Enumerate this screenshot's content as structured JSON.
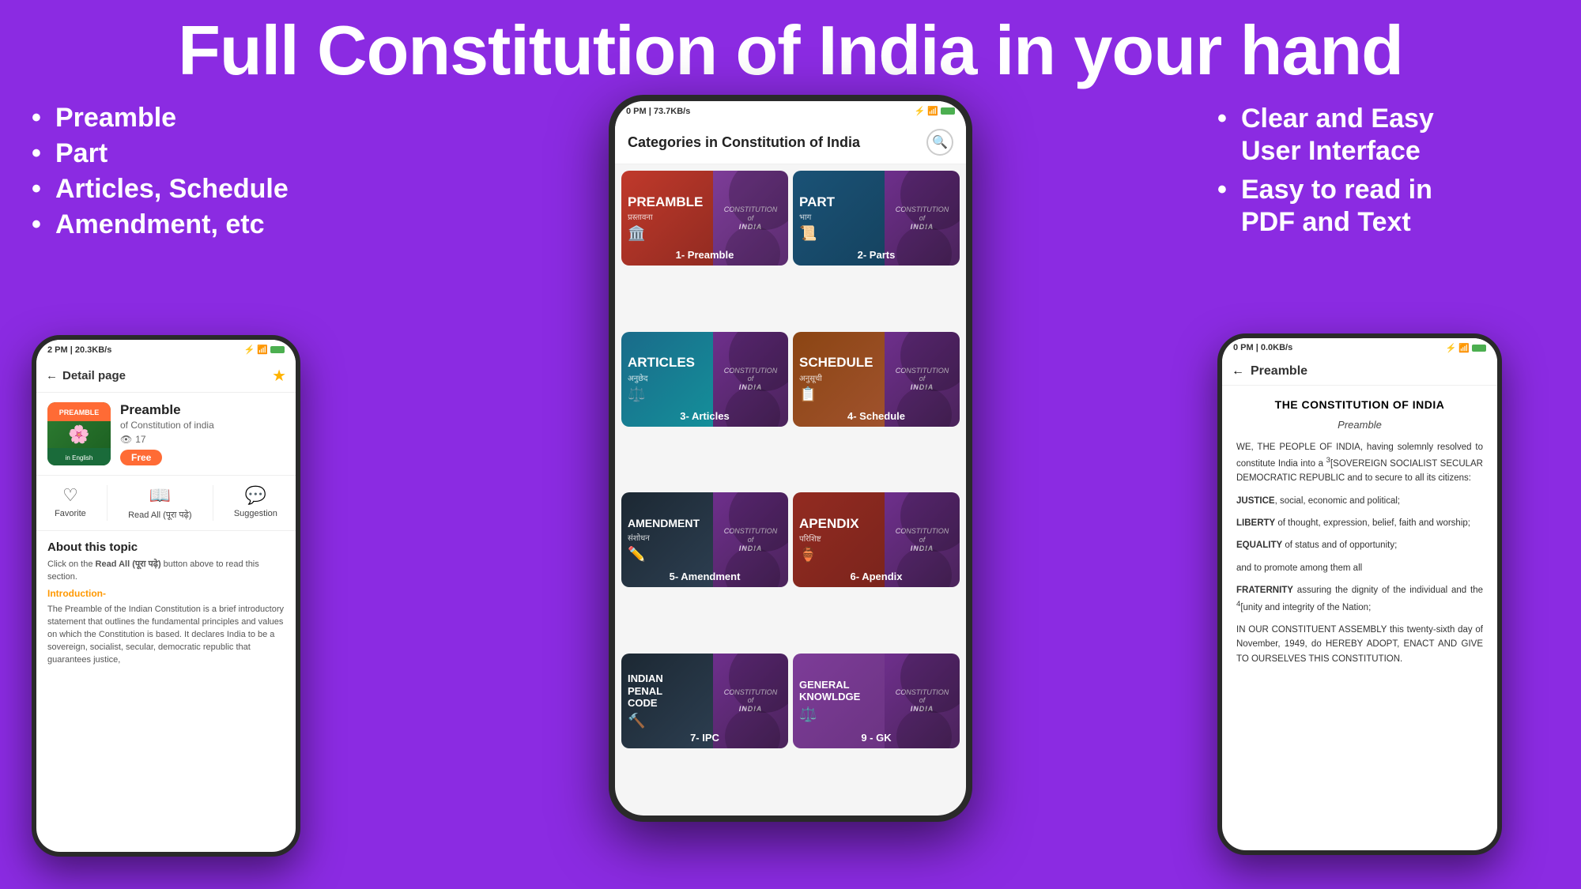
{
  "header": {
    "title": "Full Constitution of India in your hand"
  },
  "left_bullets": [
    "Preamble",
    "Part",
    "Articles, Schedule",
    "Amendment, etc"
  ],
  "right_bullets": [
    "Clear and Easy\nUser Interface",
    "Easy to read in\nPDF and Text"
  ],
  "center_phone": {
    "status_bar": "0 PM | 73.7KB/s",
    "app_title": "Categories in Constitution of India",
    "categories": [
      {
        "id": "preamble",
        "title": "PREAMBLE",
        "subtitle": "प्रस्तावना",
        "number": "1- Preamble",
        "theme": "preamble"
      },
      {
        "id": "parts",
        "title": "PART",
        "subtitle": "भाग",
        "number": "2- Parts",
        "theme": "parts"
      },
      {
        "id": "articles",
        "title": "ARTICLES",
        "subtitle": "अनुछेद",
        "number": "3- Articles",
        "theme": "articles"
      },
      {
        "id": "schedule",
        "title": "SCHEDULE",
        "subtitle": "अनुसूची",
        "number": "4- Schedule",
        "theme": "schedule"
      },
      {
        "id": "amendment",
        "title": "AMENDMENT",
        "subtitle": "संशोधन",
        "number": "5- Amendment",
        "theme": "amendment"
      },
      {
        "id": "apendix",
        "title": "APENDIX",
        "subtitle": "परिशिष्ट",
        "number": "6- Apendix",
        "theme": "apendix"
      },
      {
        "id": "ipc",
        "title": "INDIAN PENAL CODE",
        "subtitle": "",
        "number": "7- IPC",
        "theme": "ipc"
      },
      {
        "id": "gk",
        "title": "GENERAL KNOWLDGE",
        "subtitle": "",
        "number": "9 - GK",
        "theme": "gk"
      }
    ]
  },
  "left_phone": {
    "status_bar": "2 PM | 20.3KB/s",
    "page_title": "Detail page",
    "preamble_card": {
      "title": "Preamble",
      "subtitle": "of Constitution of india",
      "views": "17",
      "badge": "Free"
    },
    "actions": [
      {
        "label": "Favorite",
        "icon": "♡"
      },
      {
        "label": "Read All (पूरा पढ़े)",
        "icon": "📖"
      },
      {
        "label": "Suggestion",
        "icon": "💬"
      }
    ],
    "about_title": "About this topic",
    "about_text": "Click on the Read All (पूरा पढ़े) button above to read this section.",
    "intro_label": "Introduction-",
    "about_body": "The Preamble of the Indian Constitution is a brief introductory statement that outlines the fundamental principles and values on which the Constitution is based. It declares India to be a sovereign, socialist, secular, democratic republic that guarantees justice,"
  },
  "right_phone": {
    "status_bar": "0 PM | 0.0KB/s",
    "page_title": "Preamble",
    "main_title": "THE CONSTITUTION OF INDIA",
    "subtitle": "Preamble",
    "paragraphs": [
      "WE, THE PEOPLE OF INDIA, having solemnly resolved to constitute India into a ³[SOVEREIGN SOCIALIST SECULAR DEMOCRATIC REPUBLIC and to secure to all its citizens:",
      "JUSTICE, social, economic and political;",
      "LIBERTY of thought, expression, belief, faith and worship;",
      "EQUALITY of status and of opportunity;",
      "and to promote among them all",
      "FRATERNITY assuring the dignity of the individual and the ⁴[unity and integrity of the Nation;",
      "IN OUR CONSTITUENT ASSEMBLY this twenty-sixth day of November, 1949, do HEREBY ADOPT, ENACT AND GIVE TO OURSELVES THIS CONSTITUTION."
    ]
  }
}
